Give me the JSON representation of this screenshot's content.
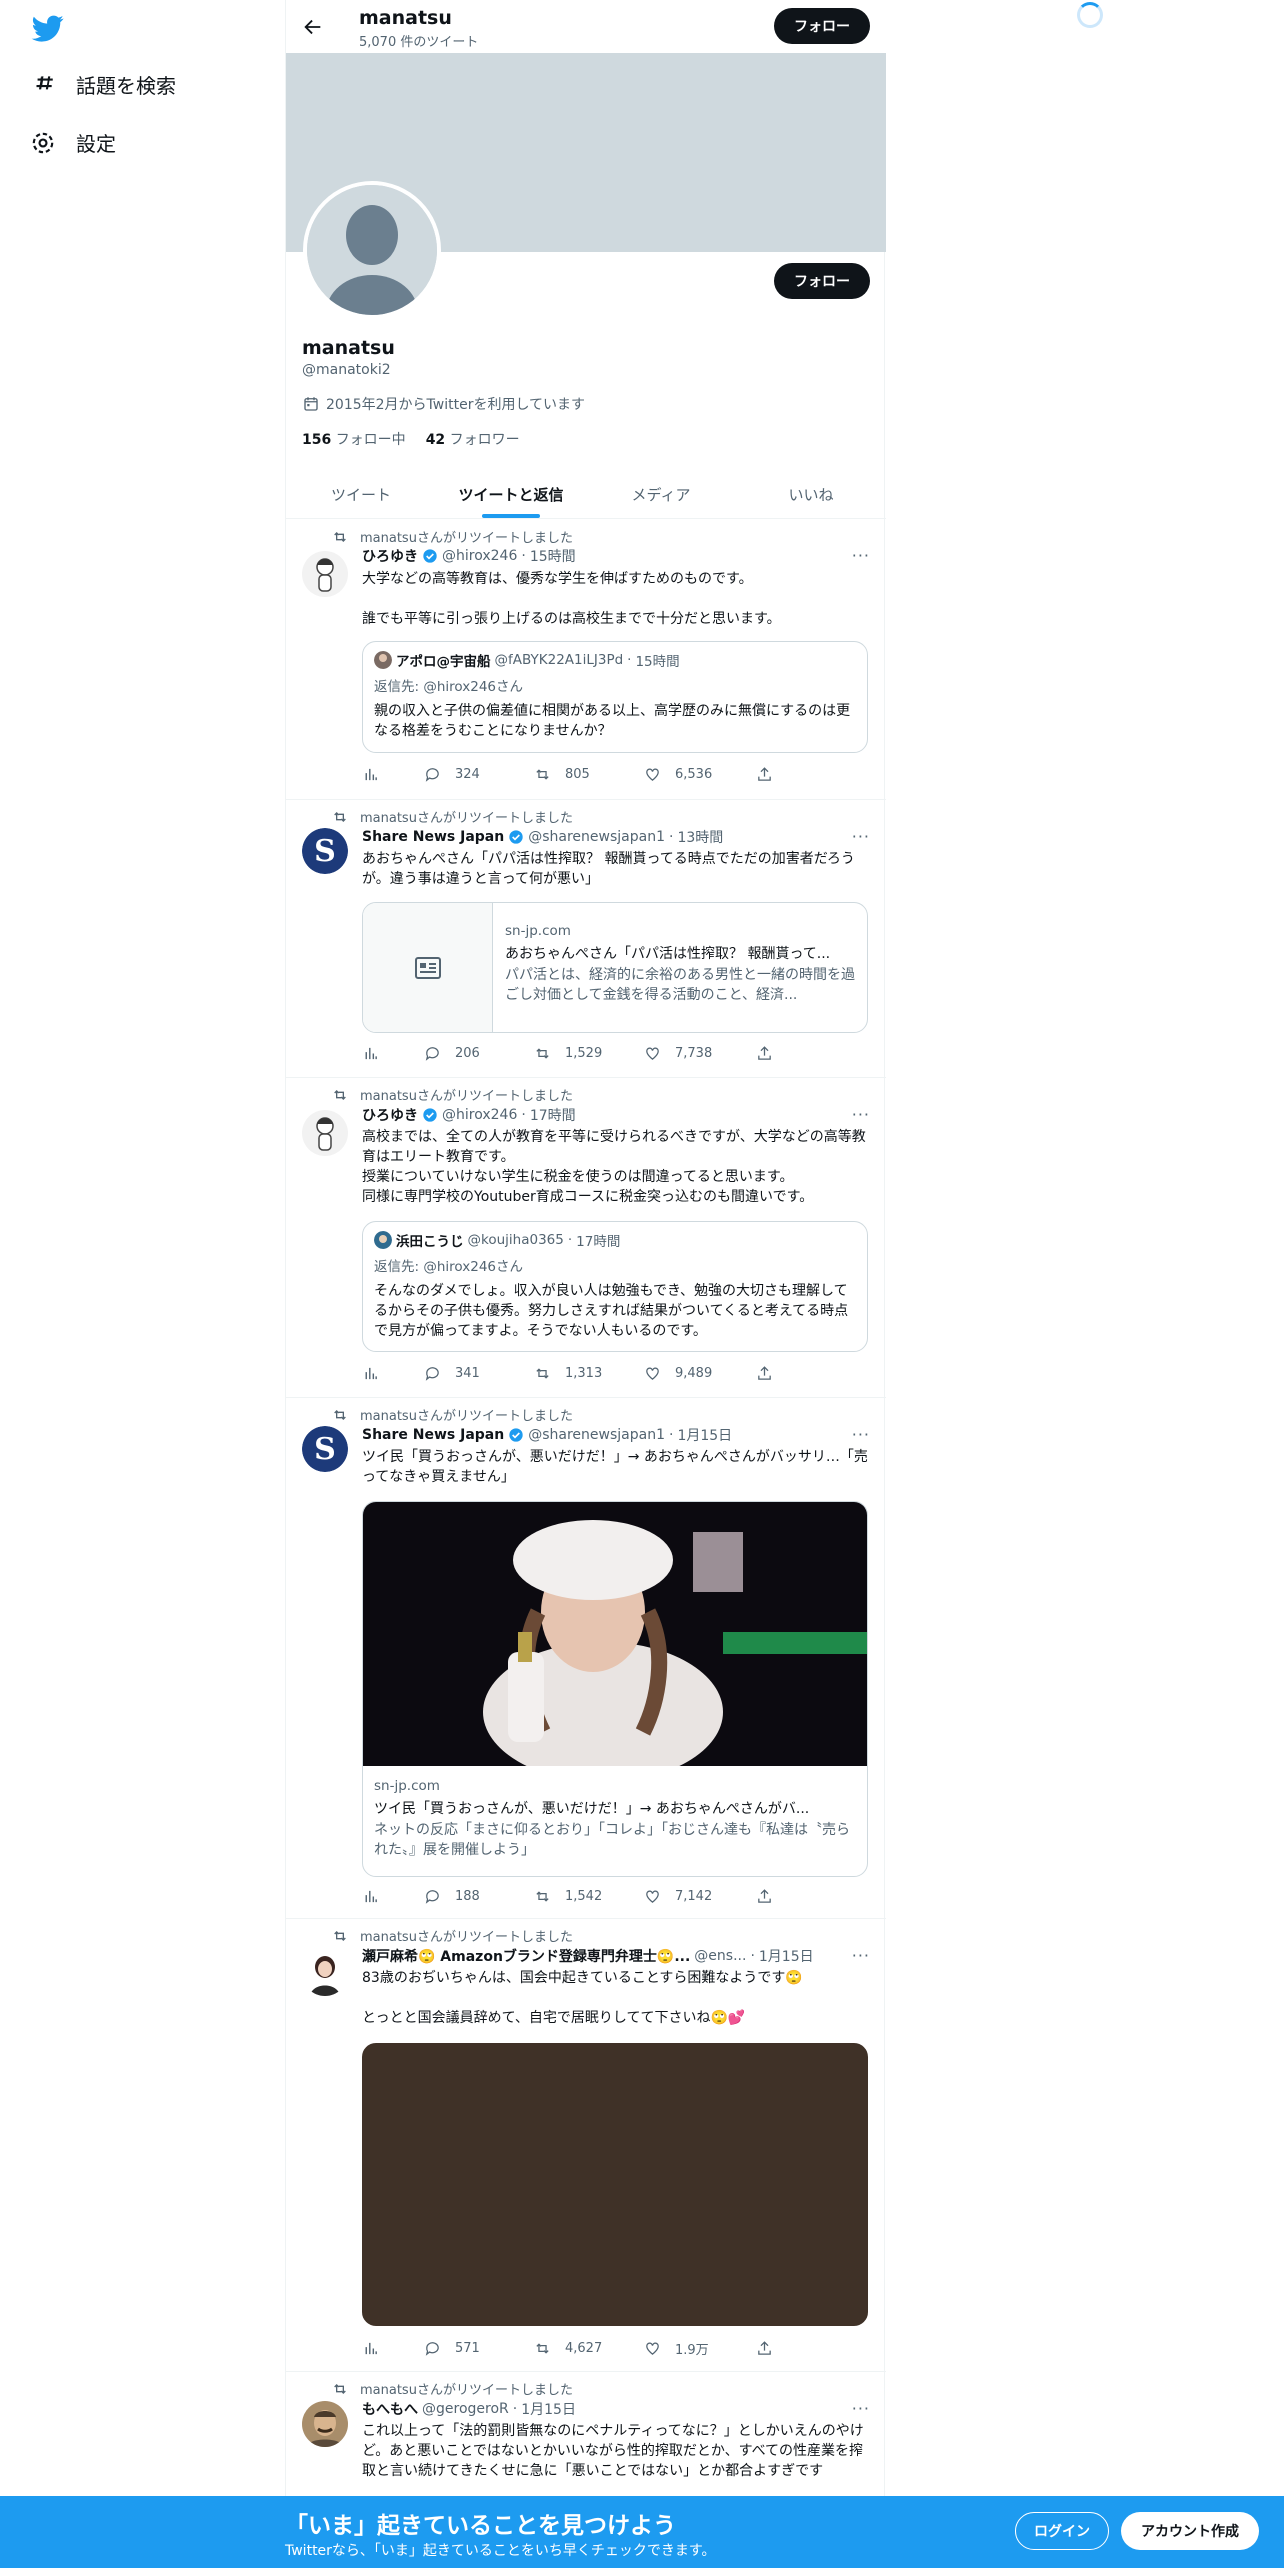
{
  "nav": {
    "explore_label": "話題を検索",
    "settings_label": "設定"
  },
  "header": {
    "name": "manatsu",
    "tweet_count": "5,070 件のツイート",
    "follow_label": "フォロー"
  },
  "profile": {
    "name": "manatsu",
    "handle": "@manatoki2",
    "joined": "2015年2月からTwitterを利用しています",
    "following_count": "156",
    "following_label": "フォロー中",
    "followers_count": "42",
    "followers_label": "フォロワー",
    "follow_label": "フォロー"
  },
  "tabs": [
    "ツイート",
    "ツイートと返信",
    "メディア",
    "いいね"
  ],
  "tweets": [
    {
      "retweet_label": "manatsuさんがリツイートしました",
      "name": "ひろゆき",
      "handle": "@hirox246",
      "time": "15時間",
      "text": "大学などの高等教育は、優秀な学生を伸ばすためのものです。\n\n誰でも平等に引っ張り上げるのは高校生までで十分だと思います。",
      "quote": {
        "name": "アポロ@宇宙船",
        "handle": "@fABYK22A1iLJ3Pd",
        "time": "15時間",
        "reply_to": "返信先: @hirox246さん",
        "text": "親の収入と子供の偏差値に相関がある以上、高学歴のみに無償にするのは更なる格差をうむことになりませんか？"
      },
      "replies": "324",
      "retweets": "805",
      "likes": "6,536"
    },
    {
      "retweet_label": "manatsuさんがリツイートしました",
      "name": "Share News Japan",
      "handle": "@sharenewsjapan1",
      "time": "13時間",
      "text": "あおちゃんぺさん「パパ活は性搾取？ 報酬貰ってる時点でただの加害者だろうが。違う事は違うと言って何が悪い」",
      "card": {
        "domain": "sn-jp.com",
        "title": "あおちゃんぺさん「パパ活は性搾取？ 報酬貰って...",
        "desc": "パパ活とは、経済的に余裕のある男性と一緒の時間を過ごし対価として金銭を得る活動のこと、経済..."
      },
      "replies": "206",
      "retweets": "1,529",
      "likes": "7,738"
    },
    {
      "retweet_label": "manatsuさんがリツイートしました",
      "name": "ひろゆき",
      "handle": "@hirox246",
      "time": "17時間",
      "text": "高校までは、全ての人が教育を平等に受けられるべきですが、大学などの高等教育はエリート教育です。\n授業についていけない学生に税金を使うのは間違ってると思います。\n同様に専門学校のYoutuber育成コースに税金突っ込むのも間違いです。",
      "quote": {
        "name": "浜田こうじ",
        "handle": "@koujiha0365",
        "time": "17時間",
        "reply_to": "返信先: @hirox246さん",
        "text": "そんなのダメでしょ。収入が良い人は勉強もでき、勉強の大切さも理解してるからその子供も優秀。努力しさえすれば結果がついてくると考えてる時点で見方が偏ってますよ。そうでない人もいるのです。"
      },
      "replies": "341",
      "retweets": "1,313",
      "likes": "9,489"
    },
    {
      "retweet_label": "manatsuさんがリツイートしました",
      "name": "Share News Japan",
      "handle": "@sharenewsjapan1",
      "time": "1月15日",
      "text": "ツイ民「買うおっさんが、悪いだけだ！」→ あおちゃんぺさんがバッサリ…「売ってなきゃ買えません」",
      "card": {
        "domain": "sn-jp.com",
        "title": "ツイ民「買うおっさんが、悪いだけだ！」→ あおちゃんぺさんがバ...",
        "desc": "ネットの反応「まさに仰るとおり」「コレよ」「おじさん達も『私達は〝売られた〟』展を開催しよう」"
      },
      "replies": "188",
      "retweets": "1,542",
      "likes": "7,142"
    },
    {
      "retweet_label": "",
      "name": "瀬戸麻希🙄 Amazonブランド登録専門弁理士🙄...",
      "handle": "@ens...",
      "time": "1月15日",
      "text": "83歳のおぢいちゃんは、国会中起きていることすら困難なようです🙄\n\nとっとと国会議員辞めて、自宅で居眠りしてて下さいね🙄💕",
      "replies": "571",
      "retweets": "4,627",
      "likes": "1.9万"
    },
    {
      "retweet_label": "manatsuさんがリツイートしました",
      "name": "もへもへ",
      "handle": "@gerogeroR",
      "time": "1月15日",
      "text": "これ以上って「法的罰則皆無なのにペナルティってなに？」としかいえんのやけど。あと悪いことではないとかいいながら性的搾取だとか、すべての性産業を搾取と言い続けてきたくせに急に「悪いことではない」とか都合よすぎです"
    }
  ],
  "bottom_bar": {
    "title": "「いま」起きていることを見つけよう",
    "subtitle": "Twitterなら、「いま」起きていることをいち早くチェックできます。",
    "login_label": "ログイン",
    "signup_label": "アカウント作成"
  },
  "colors": {
    "accent": "#1d9bf0",
    "banner": "#cfd9de",
    "text": "#0f1419",
    "muted": "#536471"
  }
}
